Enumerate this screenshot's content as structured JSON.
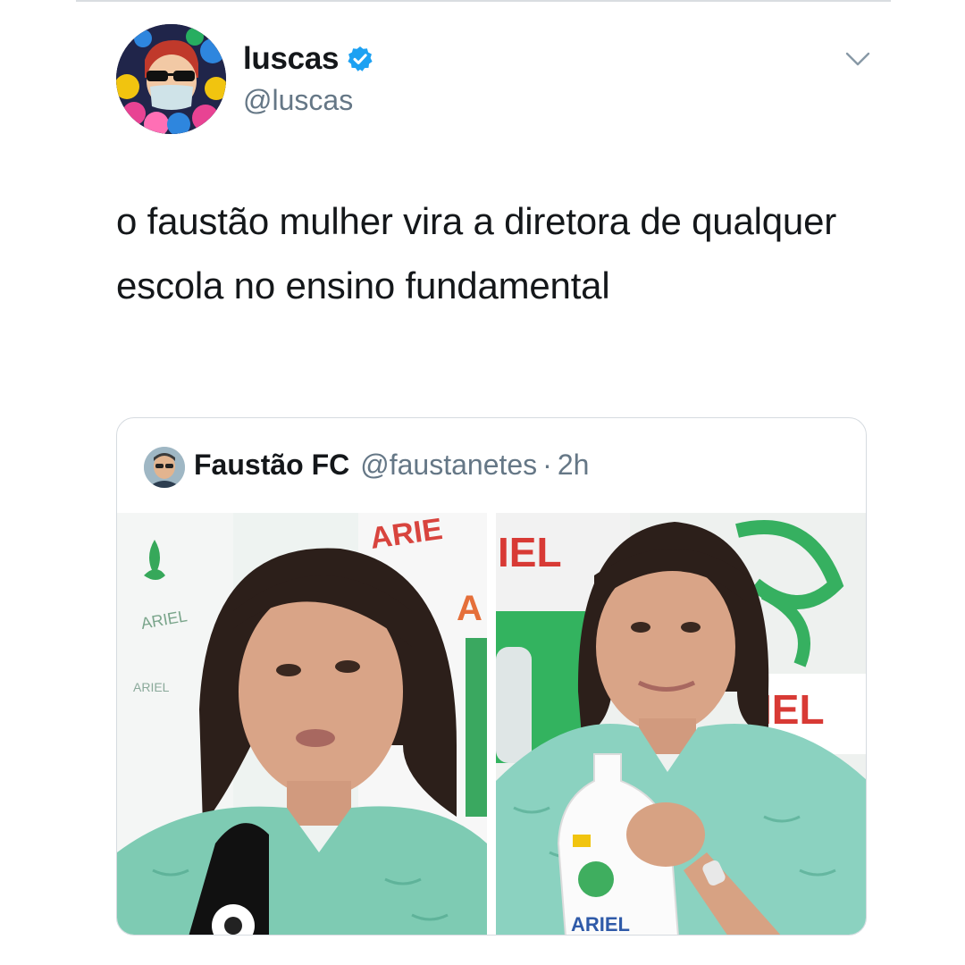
{
  "tweet": {
    "author": {
      "display_name": "luscas",
      "handle": "@luscas",
      "verified": true
    },
    "text": "o faustão mulher vira a diretora de qualquer escola no ensino fundamental"
  },
  "quoted_tweet": {
    "author": {
      "display_name": "Faustão FC",
      "handle": "@faustanetes"
    },
    "separator": "·",
    "time": "2h",
    "media": [
      {
        "kind": "photo",
        "brand_text": [
          "ARIE",
          "A",
          "ARIEL",
          "ARIEL"
        ]
      },
      {
        "kind": "photo",
        "brand_text": [
          "IEL",
          "IEL",
          "ARIEL"
        ]
      }
    ]
  },
  "colors": {
    "verified_blue": "#1da1f2",
    "text_primary": "#14171a",
    "text_secondary": "#657786",
    "card_border": "#d6dbe0"
  },
  "icons": [
    "verified-badge-icon",
    "chevron-down-icon"
  ]
}
